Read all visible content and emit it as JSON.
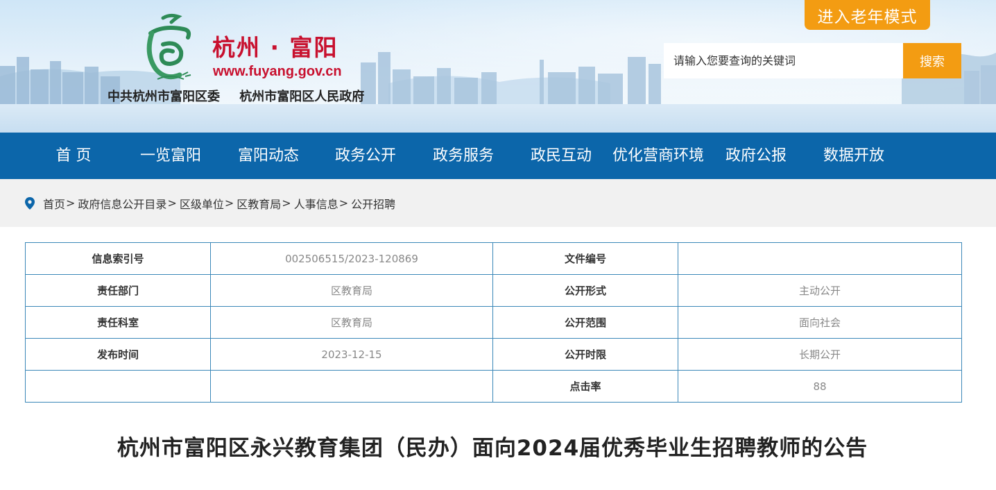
{
  "header": {
    "site_name": "杭州 · 富阳",
    "site_url": "www.fuyang.gov.cn",
    "org_party": "中共杭州市富阳区委",
    "org_government": "杭州市富阳区人民政府",
    "elder_mode_label": "进入老年模式",
    "search_placeholder": "请输入您要查询的关键词",
    "search_button": "搜索",
    "logo_icon": "fuyang-emblem-icon"
  },
  "nav": {
    "items": [
      "首 页",
      "一览富阳",
      "富阳动态",
      "政务公开",
      "政务服务",
      "政民互动",
      "优化营商环境",
      "政府公报",
      "数据开放"
    ]
  },
  "breadcrumb": {
    "icon": "location-pin-icon",
    "items": [
      "首页",
      "政府信息公开目录",
      "区级单位",
      "区教育局",
      "人事信息",
      "公开招聘"
    ],
    "separator": ">"
  },
  "info_table": {
    "rows": [
      {
        "label1": "信息索引号",
        "value1": "002506515/2023-120869",
        "label2": "文件编号",
        "value2": ""
      },
      {
        "label1": "责任部门",
        "value1": "区教育局",
        "label2": "公开形式",
        "value2": "主动公开"
      },
      {
        "label1": "责任科室",
        "value1": "区教育局",
        "label2": "公开范围",
        "value2": "面向社会"
      },
      {
        "label1": "发布时间",
        "value1": "2023-12-15",
        "label2": "公开时限",
        "value2": "长期公开"
      },
      {
        "label1": "",
        "value1": "",
        "label2": "点击率",
        "value2": "88"
      }
    ]
  },
  "article": {
    "title": "杭州市富阳区永兴教育集团（民办）面向2024届优秀毕业生招聘教师的公告"
  },
  "colors": {
    "nav_bg": "#0c66aa",
    "accent_orange": "#f39c12",
    "brand_red": "#c8102e",
    "table_border": "#3a87b8"
  }
}
